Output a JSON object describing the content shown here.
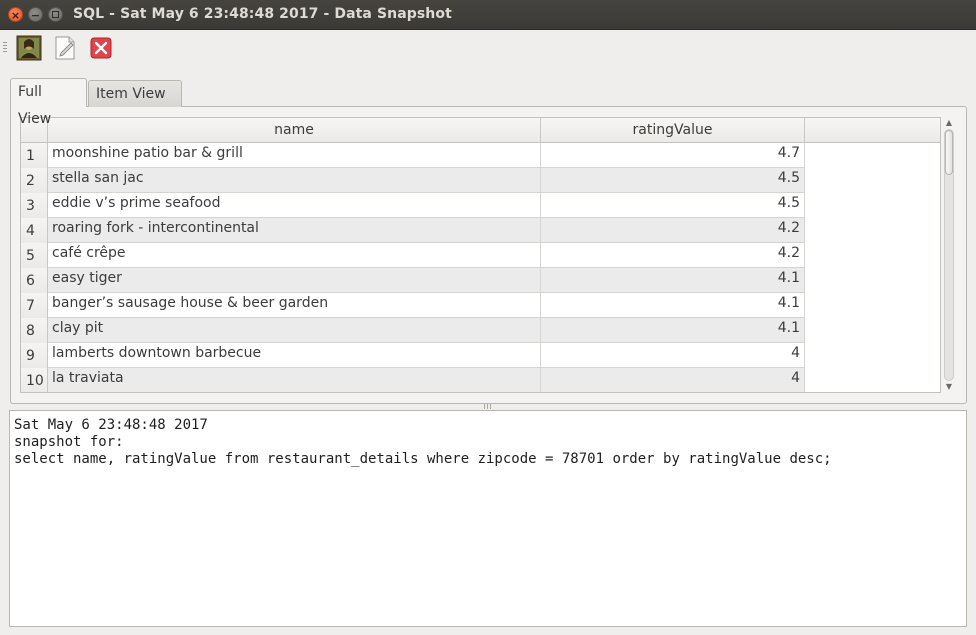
{
  "window": {
    "title": "SQL - Sat May 6 23:48:48 2017 - Data Snapshot",
    "close_glyph": "×",
    "minimize_glyph": "−"
  },
  "toolbar": {
    "items": [
      {
        "icon": "portrait-image-icon"
      },
      {
        "icon": "document-edit-icon"
      },
      {
        "icon": "delete-icon"
      }
    ]
  },
  "tabs": [
    {
      "label": "Full View",
      "active": true
    },
    {
      "label": "Item View",
      "active": false
    }
  ],
  "table": {
    "columns": [
      "name",
      "ratingValue"
    ],
    "rows": [
      {
        "index": "1",
        "name": "moonshine patio bar & grill",
        "ratingValue": "4.7"
      },
      {
        "index": "2",
        "name": "stella san jac",
        "ratingValue": "4.5"
      },
      {
        "index": "3",
        "name": "eddie v’s prime seafood",
        "ratingValue": "4.5"
      },
      {
        "index": "4",
        "name": "roaring fork - intercontinental",
        "ratingValue": "4.2"
      },
      {
        "index": "5",
        "name": "café crêpe",
        "ratingValue": "4.2"
      },
      {
        "index": "6",
        "name": "easy tiger",
        "ratingValue": "4.1"
      },
      {
        "index": "7",
        "name": "banger’s sausage house & beer garden",
        "ratingValue": "4.1"
      },
      {
        "index": "8",
        "name": "clay pit",
        "ratingValue": "4.1"
      },
      {
        "index": "9",
        "name": "lamberts downtown barbecue",
        "ratingValue": "4"
      },
      {
        "index": "10",
        "name": "la traviata",
        "ratingValue": "4"
      }
    ]
  },
  "snapshot": {
    "timestamp": "Sat May 6 23:48:48 2017",
    "label": "snapshot for:",
    "query": "select name, ratingValue from restaurant_details where zipcode = 78701 order by ratingValue desc;"
  },
  "colors": {
    "titlebar": "#3c3b37",
    "close_button": "#e0541e",
    "row_alt": "#ebebeb"
  }
}
